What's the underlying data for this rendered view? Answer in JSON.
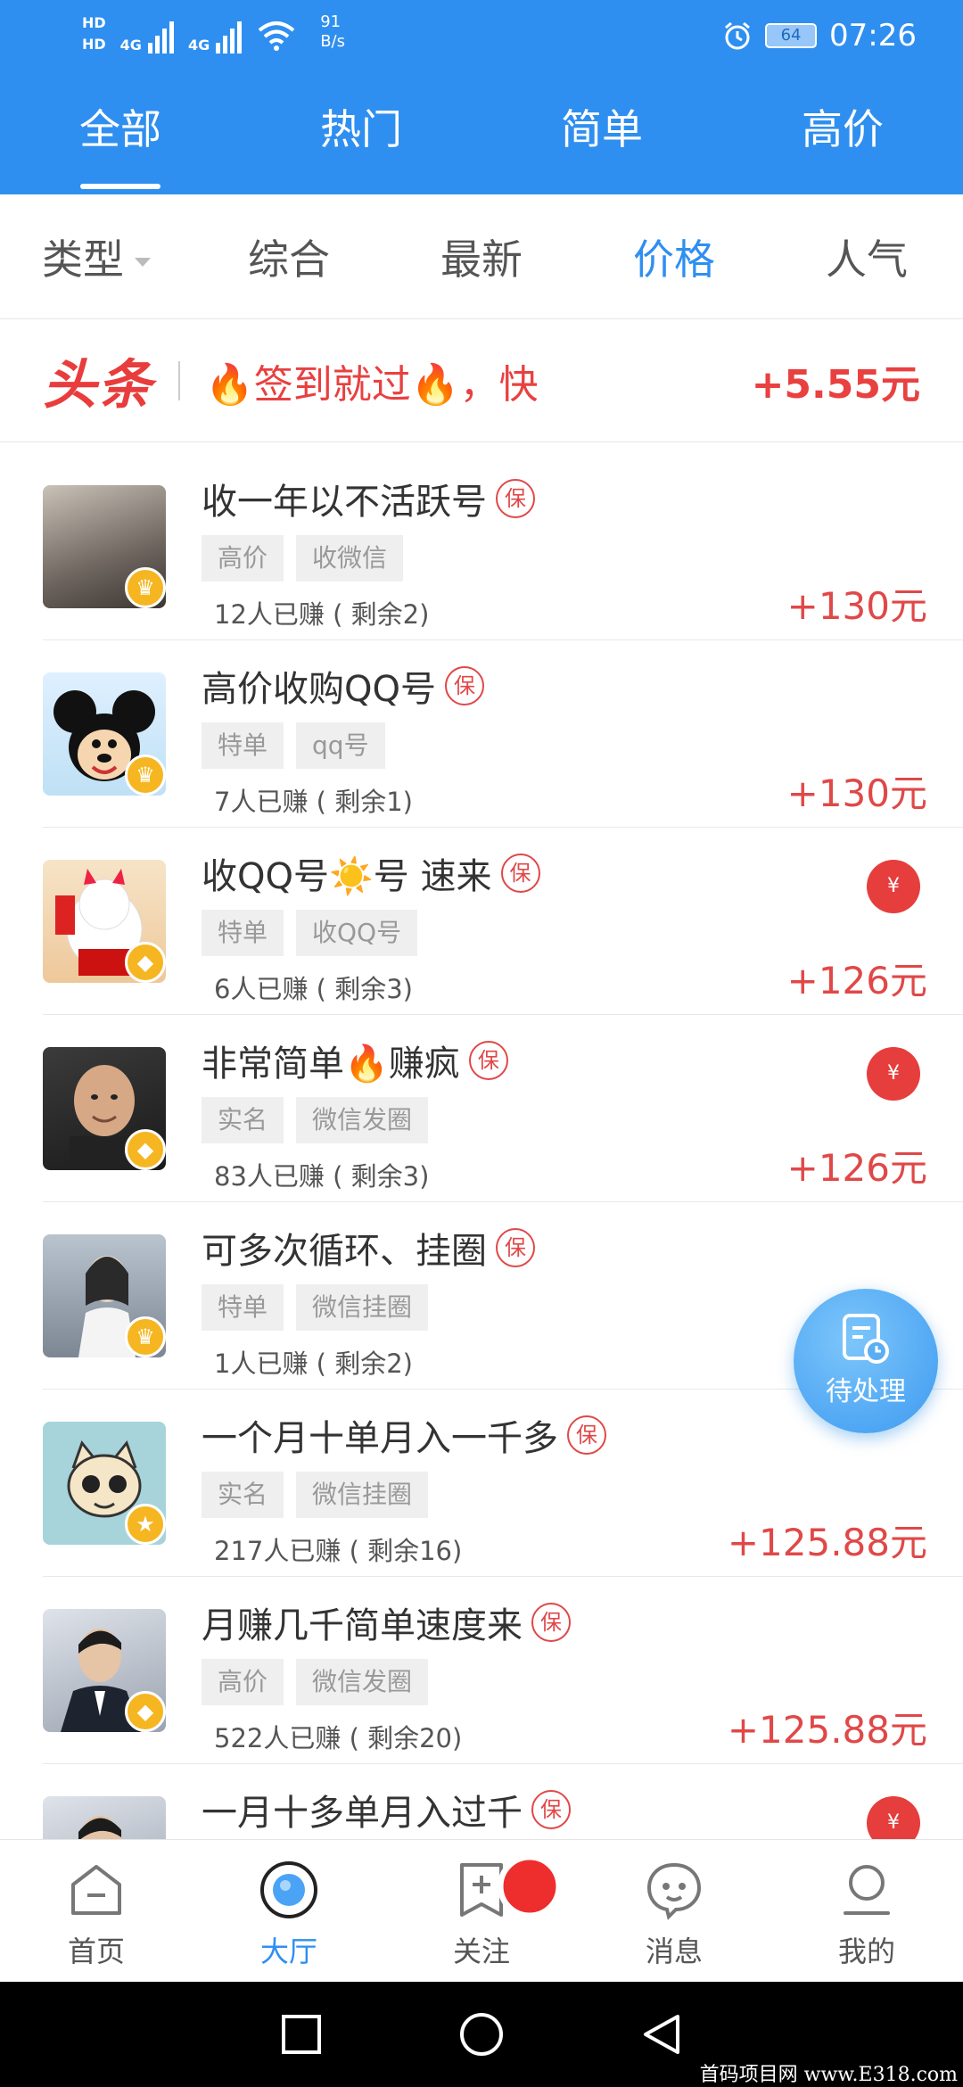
{
  "status": {
    "hd1": "HD",
    "hd2": "HD",
    "net1": "4G",
    "net2": "4G",
    "speed_value": "91",
    "speed_unit": "B/s",
    "battery": "64",
    "time": "07:26"
  },
  "top_tabs": [
    "全部",
    "热门",
    "简单",
    "高价"
  ],
  "filters": {
    "type_label": "类型",
    "options": [
      "综合",
      "最新",
      "价格",
      "人气"
    ]
  },
  "headline": {
    "logo": "头条",
    "text": "🔥签到就过🔥，快",
    "reward": "+5.55元"
  },
  "tasks": [
    {
      "title": "收一年以不活跃号",
      "bao": "保",
      "tags": [
        "高价",
        "收微信"
      ],
      "earned": "12人已赚 ( 剩余2)",
      "price": "+130元",
      "badge": "crown"
    },
    {
      "title": "高价收购QQ号",
      "bao": "保",
      "tags": [
        "特单",
        "qq号"
      ],
      "earned": "7人已赚 ( 剩余1)",
      "price": "+130元",
      "badge": "crown"
    },
    {
      "title": "收QQ号☀️号 速来",
      "bao": "保",
      "tags": [
        "特单",
        "收QQ号"
      ],
      "earned": "6人已赚 ( 剩余3)",
      "price": "+126元",
      "badge": "diamond",
      "redpack": "¥"
    },
    {
      "title": "非常简单🔥赚疯",
      "bao": "保",
      "tags": [
        "实名",
        "微信发圈"
      ],
      "earned": "83人已赚 ( 剩余3)",
      "price": "+126元",
      "badge": "diamond",
      "redpack": "¥"
    },
    {
      "title": "可多次循环、挂圈",
      "bao": "保",
      "tags": [
        "特单",
        "微信挂圈"
      ],
      "earned": "1人已赚 ( 剩余2)",
      "price": "",
      "badge": "crown"
    },
    {
      "title": "一个月十单月入一千多",
      "bao": "保",
      "tags": [
        "实名",
        "微信挂圈"
      ],
      "earned": "217人已赚 ( 剩余16)",
      "price": "+125.88元",
      "badge": "star"
    },
    {
      "title": "月赚几千简单速度来",
      "bao": "保",
      "tags": [
        "高价",
        "微信发圈"
      ],
      "earned": "522人已赚 ( 剩余20)",
      "price": "+125.88元",
      "badge": "diamond"
    },
    {
      "title": "一月十多单月入过千",
      "bao": "保",
      "tags": [],
      "earned": "",
      "price": "",
      "badge": "",
      "redpack": "¥"
    }
  ],
  "pending_button": "待处理",
  "bottom_nav": [
    {
      "label": "首页",
      "icon": "home-icon"
    },
    {
      "label": "大厅",
      "icon": "hall-icon"
    },
    {
      "label": "关注",
      "icon": "follow-icon"
    },
    {
      "label": "消息",
      "icon": "message-icon"
    },
    {
      "label": "我的",
      "icon": "profile-icon"
    }
  ],
  "watermark": "首码项目网 www.E318.com",
  "colors": {
    "primary": "#2f8ff0",
    "accent_red": "#e04848",
    "badge_gold": "#f5b622"
  }
}
